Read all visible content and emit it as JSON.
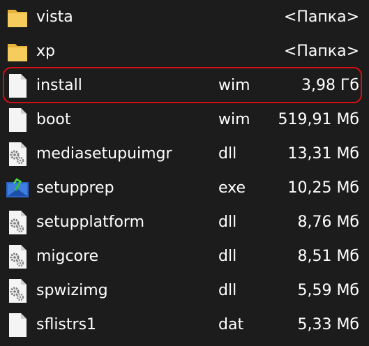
{
  "files": [
    {
      "name": "vista",
      "ext": "",
      "size": "<Папка>",
      "icon": "folder-icon"
    },
    {
      "name": "xp",
      "ext": "",
      "size": "<Папка>",
      "icon": "folder-icon"
    },
    {
      "name": "install",
      "ext": "wim",
      "size": "3,98 Гб",
      "icon": "file-icon"
    },
    {
      "name": "boot",
      "ext": "wim",
      "size": "519,91 Мб",
      "icon": "file-icon"
    },
    {
      "name": "mediasetupuimgr",
      "ext": "dll",
      "size": "13,31 Мб",
      "icon": "dll-gear-icon"
    },
    {
      "name": "setupprep",
      "ext": "exe",
      "size": "10,25 Мб",
      "icon": "setup-exe-icon"
    },
    {
      "name": "setupplatform",
      "ext": "dll",
      "size": "8,76 Мб",
      "icon": "dll-gear-icon"
    },
    {
      "name": "migcore",
      "ext": "dll",
      "size": "8,51 Мб",
      "icon": "dll-gear-icon"
    },
    {
      "name": "spwizimg",
      "ext": "dll",
      "size": "5,59 Мб",
      "icon": "dll-gear-icon"
    },
    {
      "name": "sflistrs1",
      "ext": "dat",
      "size": "5,33 Мб",
      "icon": "file-icon"
    }
  ],
  "highlighted_row": 2,
  "colors": {
    "background": "#1c1c1c",
    "text": "#ffffff",
    "highlight_border": "#d40f14",
    "folder": "#f2c24a"
  }
}
